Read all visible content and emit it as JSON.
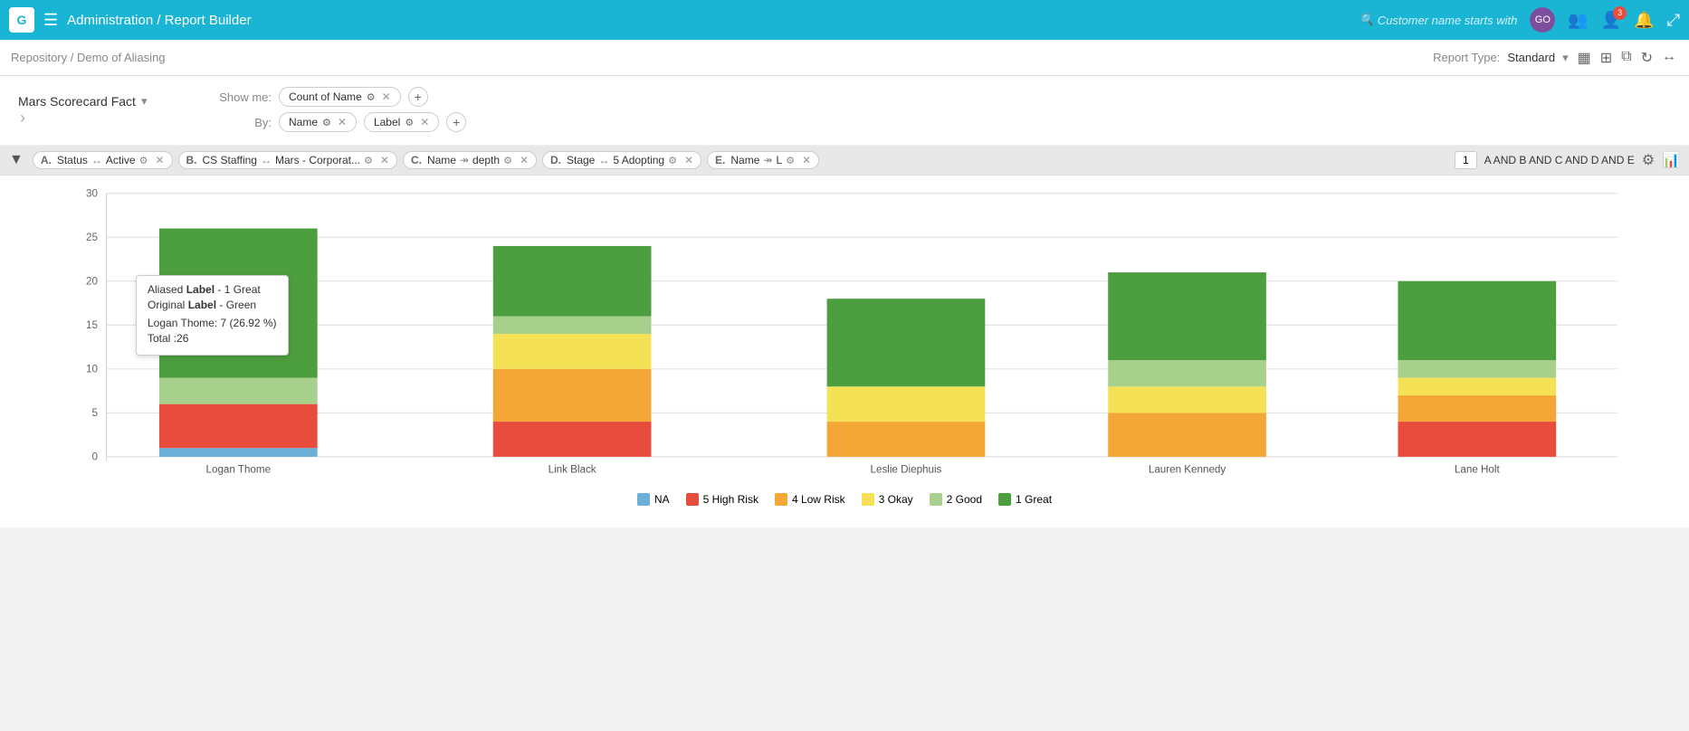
{
  "topNav": {
    "logo": "G",
    "title": "Administration / Report Builder",
    "searchPlaceholder": "Customer name starts with",
    "avatarText": "GO",
    "badgeCount": "3"
  },
  "subNav": {
    "breadcrumb": "Repository / Demo of Aliasing",
    "reportTypeLabel": "Report Type:",
    "reportTypeValue": "Standard"
  },
  "showMe": {
    "label": "Show me:",
    "pill": "Count of Name",
    "addLabel": "+"
  },
  "by": {
    "label": "By:",
    "pills": [
      "Name",
      "Label"
    ],
    "addLabel": "+"
  },
  "filters": {
    "items": [
      {
        "id": "A",
        "name": "Status",
        "arrow": "↔",
        "value": "Active",
        "icon": "⚙",
        "hasX": true
      },
      {
        "id": "B",
        "name": "CS Staffing",
        "arrow": "↔",
        "value": "Mars - Corporat...",
        "icon": "⚙",
        "hasX": true
      },
      {
        "id": "C",
        "name": "Name",
        "arrow": "↠",
        "value": "depth",
        "icon": "⚙",
        "hasX": true
      },
      {
        "id": "D",
        "name": "Stage",
        "arrow": "↔",
        "value": "5 Adopting",
        "icon": "⚙",
        "hasX": true
      },
      {
        "id": "E",
        "name": "Name",
        "arrow": "↠",
        "value": "L",
        "icon": "⚙",
        "hasX": true
      }
    ],
    "conditionNum": "1",
    "conditionText": "A AND B AND C AND D AND E"
  },
  "chart": {
    "yMax": 30,
    "yTicks": [
      0,
      5,
      10,
      15,
      20,
      25,
      30
    ],
    "bars": [
      {
        "name": "Logan Thome",
        "segments": [
          {
            "label": "NA",
            "value": 1,
            "color": "#6baed6"
          },
          {
            "label": "5 High Risk",
            "value": 5,
            "color": "#e74c3c"
          },
          {
            "label": "4 Low Risk",
            "value": 0,
            "color": ""
          },
          {
            "label": "3 Okay",
            "value": 0,
            "color": ""
          },
          {
            "label": "2 Good",
            "value": 3,
            "color": "#a8d08d"
          },
          {
            "label": "1 Great",
            "value": 17,
            "color": "#4d9e3f"
          }
        ],
        "total": 26,
        "hovered": true
      },
      {
        "name": "Link Black",
        "segments": [
          {
            "label": "NA",
            "value": 0,
            "color": ""
          },
          {
            "label": "5 High Risk",
            "value": 4,
            "color": "#e74c3c"
          },
          {
            "label": "4 Low Risk",
            "value": 6,
            "color": "#f4a636"
          },
          {
            "label": "3 Okay",
            "value": 4,
            "color": "#f4e156"
          },
          {
            "label": "2 Good",
            "value": 2,
            "color": "#a8d08d"
          },
          {
            "label": "1 Great",
            "value": 8,
            "color": "#4d9e3f"
          }
        ],
        "total": 24,
        "hovered": false
      },
      {
        "name": "Leslie Diephuis",
        "segments": [
          {
            "label": "NA",
            "value": 0,
            "color": ""
          },
          {
            "label": "5 High Risk",
            "value": 0,
            "color": ""
          },
          {
            "label": "4 Low Risk",
            "value": 4,
            "color": "#f4a636"
          },
          {
            "label": "3 Okay",
            "value": 4,
            "color": "#f4e156"
          },
          {
            "label": "2 Good",
            "value": 0,
            "color": ""
          },
          {
            "label": "1 Great",
            "value": 10,
            "color": "#4d9e3f"
          }
        ],
        "total": 18,
        "hovered": false
      },
      {
        "name": "Lauren Kennedy",
        "segments": [
          {
            "label": "NA",
            "value": 0,
            "color": ""
          },
          {
            "label": "5 High Risk",
            "value": 0,
            "color": ""
          },
          {
            "label": "4 Low Risk",
            "value": 5,
            "color": "#f4a636"
          },
          {
            "label": "3 Okay",
            "value": 3,
            "color": "#f4e156"
          },
          {
            "label": "2 Good",
            "value": 3,
            "color": "#a8d08d"
          },
          {
            "label": "1 Great",
            "value": 10,
            "color": "#4d9e3f"
          }
        ],
        "total": 21,
        "hovered": false
      },
      {
        "name": "Lane Holt",
        "segments": [
          {
            "label": "NA",
            "value": 0,
            "color": ""
          },
          {
            "label": "5 High Risk",
            "value": 4,
            "color": "#e74c3c"
          },
          {
            "label": "4 Low Risk",
            "value": 3,
            "color": "#f4a636"
          },
          {
            "label": "3 Okay",
            "value": 2,
            "color": "#f4e156"
          },
          {
            "label": "2 Good",
            "value": 2,
            "color": "#a8d08d"
          },
          {
            "label": "1 Great",
            "value": 9,
            "color": "#4d9e3f"
          }
        ],
        "total": 20,
        "hovered": false
      }
    ],
    "tooltip": {
      "aliasedLabel": "Aliased",
      "labelWord": "Label",
      "value1": "- 1 Great",
      "originalLabel": "Original",
      "labelWord2": "Label",
      "value2": "- Green",
      "personName": "Logan Thome:",
      "personValue": "7 (26.92 %)",
      "totalLabel": "Total :",
      "totalValue": "26"
    },
    "legend": [
      {
        "label": "NA",
        "color": "#6baed6"
      },
      {
        "label": "5 High Risk",
        "color": "#e74c3c"
      },
      {
        "label": "4 Low Risk",
        "color": "#f4a636"
      },
      {
        "label": "3 Okay",
        "color": "#f4e156"
      },
      {
        "label": "2 Good",
        "color": "#a8d08d"
      },
      {
        "label": "1 Great",
        "color": "#4d9e3f"
      }
    ]
  }
}
